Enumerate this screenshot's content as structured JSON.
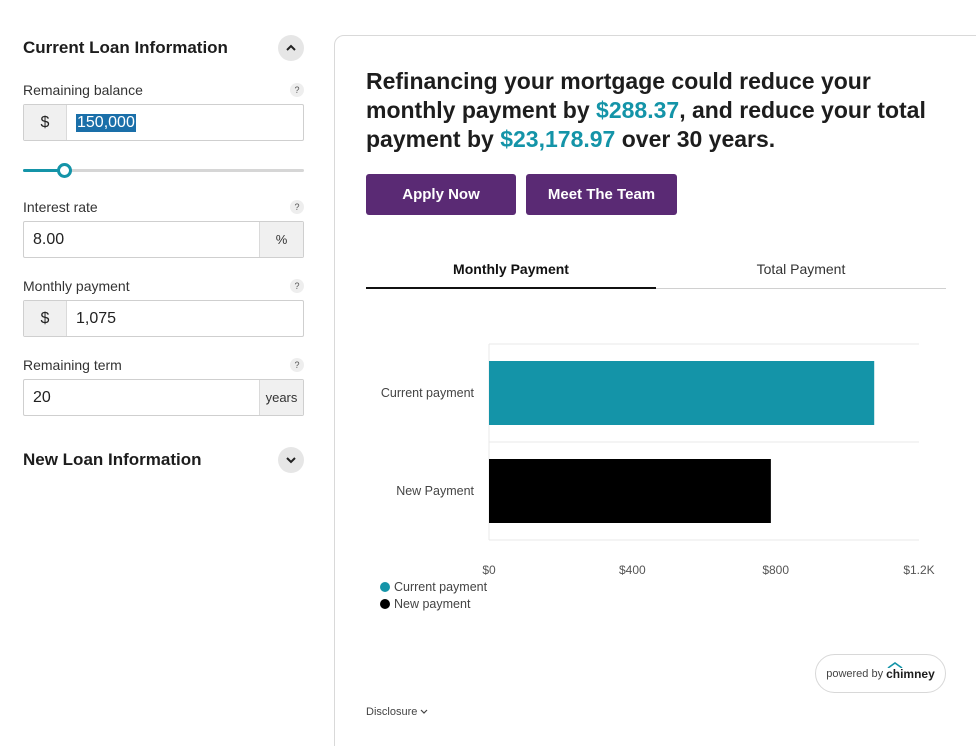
{
  "current_loan": {
    "title": "Current Loan Information",
    "help": "?",
    "fields": {
      "balance": {
        "label": "Remaining balance",
        "prefix": "$",
        "value": "150,000"
      },
      "rate": {
        "label": "Interest rate",
        "value": "8.00",
        "suffix": "%"
      },
      "payment": {
        "label": "Monthly payment",
        "prefix": "$",
        "value": "1,075"
      },
      "term": {
        "label": "Remaining term",
        "value": "20",
        "suffix": "years"
      }
    },
    "balance_slider_level": 0.15
  },
  "new_loan": {
    "title": "New Loan Information"
  },
  "summary": {
    "part1": "Refinancing your mortgage could reduce your monthly payment by ",
    "monthly_savings": "$288.37",
    "part2": ", and reduce your total payment by ",
    "total_savings": "$23,178.97",
    "part3": " over 30 years."
  },
  "buttons": {
    "apply": "Apply Now",
    "team": "Meet The Team"
  },
  "tabs": [
    {
      "label": "Monthly Payment",
      "active": true
    },
    {
      "label": "Total Payment",
      "active": false
    }
  ],
  "chart_data": {
    "type": "bar",
    "orientation": "horizontal",
    "categories": [
      "Current payment",
      "New Payment"
    ],
    "values": [
      1075,
      786.63
    ],
    "colors": [
      "#1494a8",
      "#000000"
    ],
    "xlim": [
      0,
      1200
    ],
    "x_ticks": [
      0,
      400,
      800,
      1200
    ],
    "x_tick_labels": [
      "$0",
      "$400",
      "$800",
      "$1.2K"
    ],
    "legend": [
      {
        "label": "Current payment",
        "color": "#1494a8"
      },
      {
        "label": "New payment",
        "color": "#000000"
      }
    ],
    "legend_position": "bottom-left",
    "grid": true
  },
  "footer": {
    "powered_prefix": "powered by",
    "powered_brand": "chimney",
    "disclosure": "Disclosure"
  },
  "colors": {
    "accent": "#1494a8",
    "button": "#5a2a74"
  }
}
